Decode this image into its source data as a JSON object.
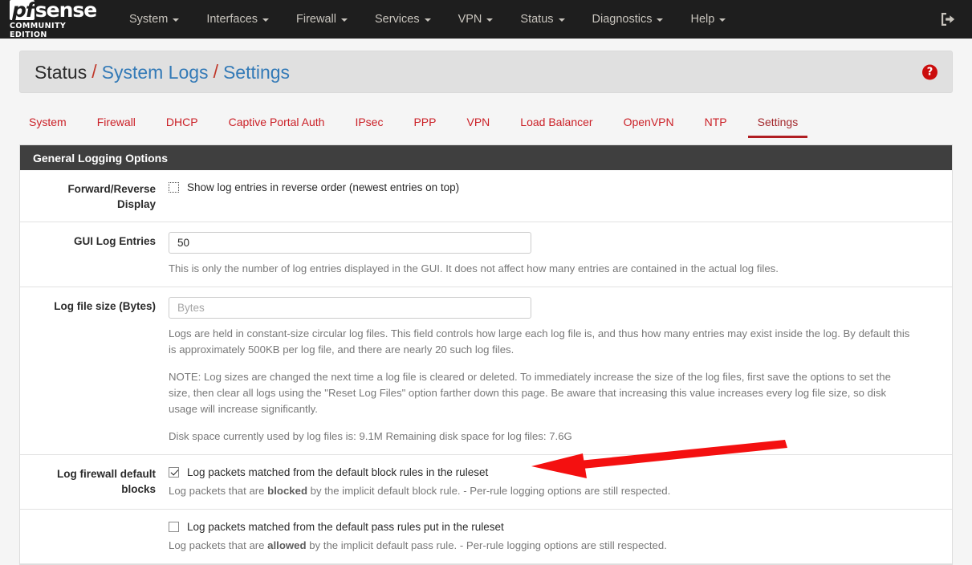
{
  "navbar": {
    "brand": {
      "logo_pf": "pf",
      "logo_sense": "sense",
      "subtitle": "COMMUNITY EDITION"
    },
    "items": [
      {
        "label": "System",
        "has_caret": true
      },
      {
        "label": "Interfaces",
        "has_caret": true
      },
      {
        "label": "Firewall",
        "has_caret": true
      },
      {
        "label": "Services",
        "has_caret": true
      },
      {
        "label": "VPN",
        "has_caret": true
      },
      {
        "label": "Status",
        "has_caret": true
      },
      {
        "label": "Diagnostics",
        "has_caret": true
      },
      {
        "label": "Help",
        "has_caret": true
      }
    ],
    "logout_icon": "sign-out-icon"
  },
  "breadcrumb": {
    "root": "Status",
    "sep1": "/",
    "middle": "System Logs",
    "sep2": "/",
    "current": "Settings",
    "help_icon_label": "?"
  },
  "tabs": [
    {
      "label": "System",
      "active": false
    },
    {
      "label": "Firewall",
      "active": false
    },
    {
      "label": "DHCP",
      "active": false
    },
    {
      "label": "Captive Portal Auth",
      "active": false
    },
    {
      "label": "IPsec",
      "active": false
    },
    {
      "label": "PPP",
      "active": false
    },
    {
      "label": "VPN",
      "active": false
    },
    {
      "label": "Load Balancer",
      "active": false
    },
    {
      "label": "OpenVPN",
      "active": false
    },
    {
      "label": "NTP",
      "active": false
    },
    {
      "label": "Settings",
      "active": true
    }
  ],
  "panel": {
    "title": "General Logging Options",
    "rows": {
      "forward_reverse": {
        "label": "Forward/Reverse Display",
        "checkbox_label": "Show log entries in reverse order (newest entries on top)",
        "checked": false
      },
      "gui_log_entries": {
        "label": "GUI Log Entries",
        "value": "50",
        "placeholder": "",
        "help": "This is only the number of log entries displayed in the GUI. It does not affect how many entries are contained in the actual log files."
      },
      "log_file_size": {
        "label": "Log file size (Bytes)",
        "value": "",
        "placeholder": "Bytes",
        "help1": "Logs are held in constant-size circular log files. This field controls how large each log file is, and thus how many entries may exist inside the log. By default this is approximately 500KB per log file, and there are nearly 20 such log files.",
        "help2": "NOTE: Log sizes are changed the next time a log file is cleared or deleted. To immediately increase the size of the log files, first save the options to set the size, then clear all logs using the \"Reset Log Files\" option farther down this page. Be aware that increasing this value increases every log file size, so disk usage will increase significantly.",
        "help3": "Disk space currently used by log files is: 9.1M Remaining disk space for log files: 7.6G"
      },
      "firewall_default_blocks": {
        "label_line1": "Log firewall default",
        "label_line2": "blocks",
        "checkbox_label": "Log packets matched from the default block rules in the ruleset",
        "checked": true,
        "help_pre": "Log packets that are ",
        "help_bold": "blocked",
        "help_post": " by the implicit default block rule. - Per-rule logging options are still respected."
      },
      "firewall_default_pass": {
        "checkbox_label": "Log packets matched from the default pass rules put in the ruleset",
        "checked": false,
        "help_pre": "Log packets that are ",
        "help_bold": "allowed",
        "help_post": " by the implicit default pass rule. - Per-rule logging options are still respected."
      }
    }
  },
  "annotation": {
    "arrow_color": "#f41010",
    "type": "arrow-pointing-left"
  }
}
